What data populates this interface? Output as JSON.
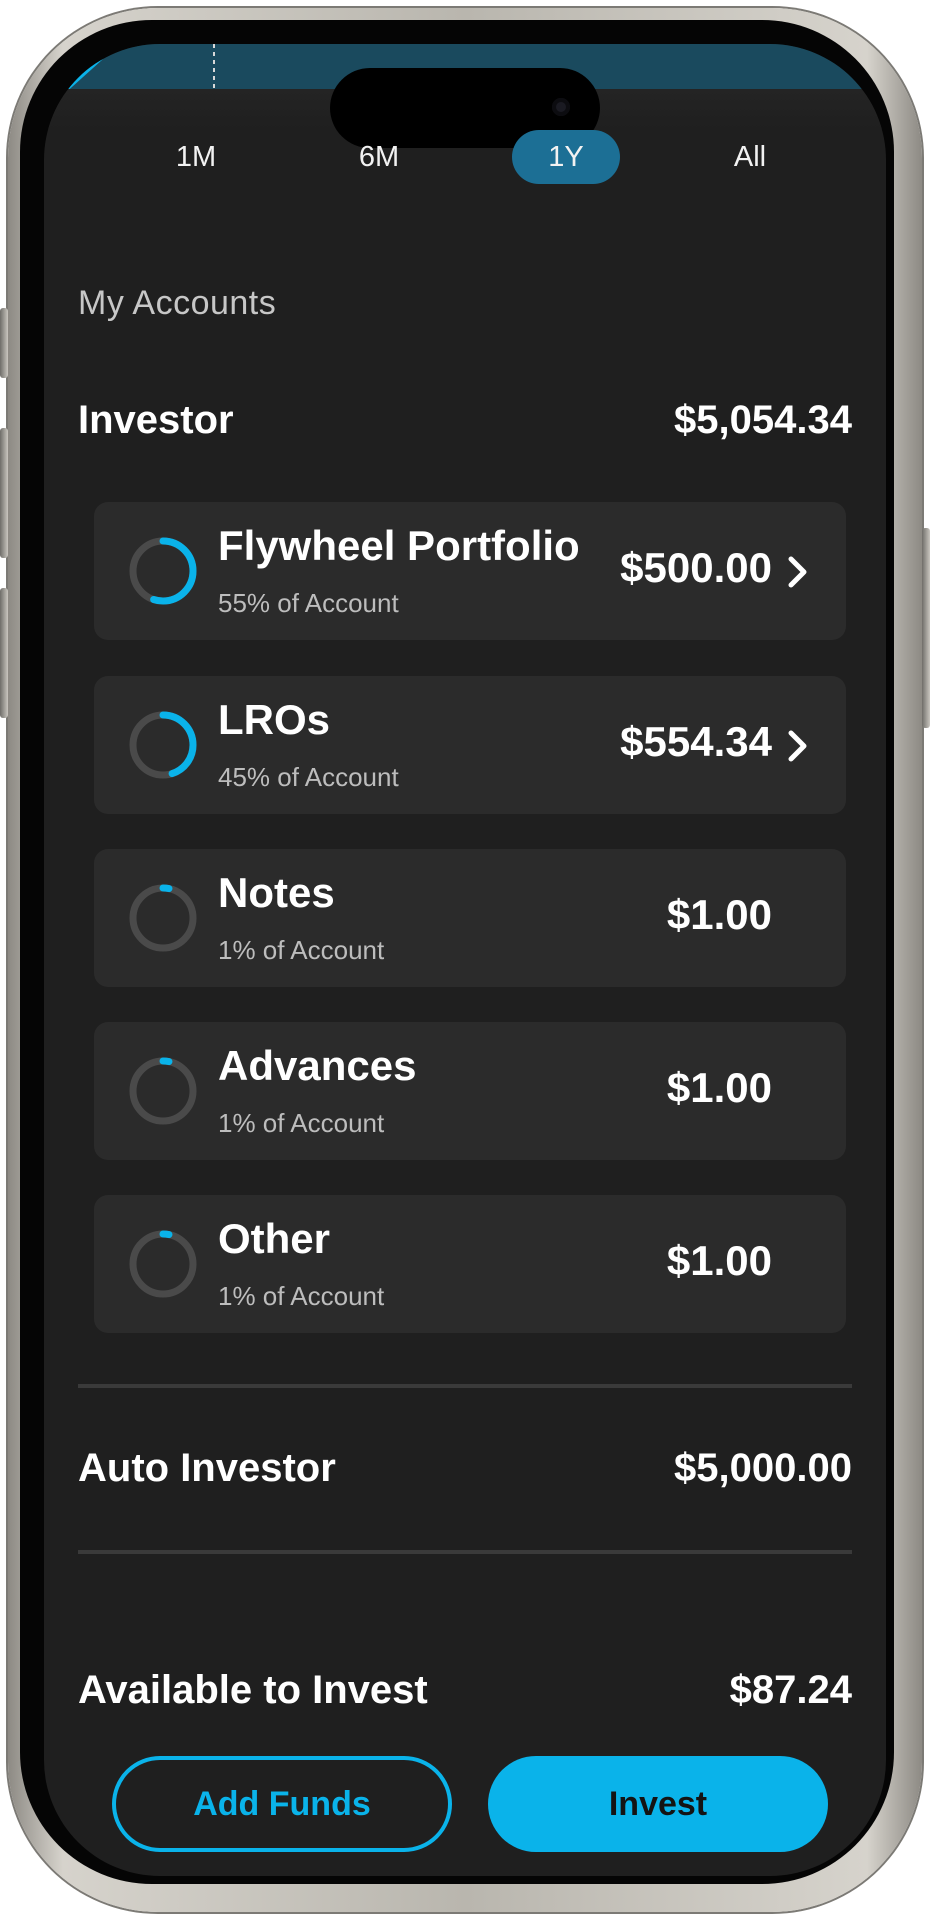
{
  "range_tabs": [
    {
      "label": "1M",
      "active": false
    },
    {
      "label": "6M",
      "active": false
    },
    {
      "label": "1Y",
      "active": true
    },
    {
      "label": "All",
      "active": false
    }
  ],
  "accounts": {
    "section_title": "My Accounts",
    "investor": {
      "label": "Investor",
      "total": "$5,054.34",
      "items": [
        {
          "name": "Flywheel Portfolio",
          "share_text": "55% of Account",
          "share": 0.55,
          "amount": "$500.00",
          "has_chevron": true
        },
        {
          "name": "LROs",
          "share_text": "45% of Account",
          "share": 0.45,
          "amount": "$554.34",
          "has_chevron": true
        },
        {
          "name": "Notes",
          "share_text": "1% of Account",
          "share": 0.01,
          "amount": "$1.00",
          "has_chevron": false
        },
        {
          "name": "Advances",
          "share_text": "1% of Account",
          "share": 0.01,
          "amount": "$1.00",
          "has_chevron": false
        },
        {
          "name": "Other",
          "share_text": "1% of Account",
          "share": 0.01,
          "amount": "$1.00",
          "has_chevron": false
        }
      ]
    },
    "auto_investor": {
      "label": "Auto Investor",
      "total": "$5,000.00"
    },
    "available": {
      "label": "Available to Invest",
      "total": "$87.24"
    }
  },
  "actions": {
    "add_funds": "Add Funds",
    "invest": "Invest"
  },
  "icons": {
    "chevron": "chevron-right-icon",
    "ring": "allocation-ring-icon"
  },
  "colors": {
    "accent": "#0ab3ea",
    "tab_active": "#1c6f95",
    "card_bg": "#2b2b2b",
    "screen_bg": "#1f1f1f",
    "ring_track": "#4a4a4a"
  }
}
